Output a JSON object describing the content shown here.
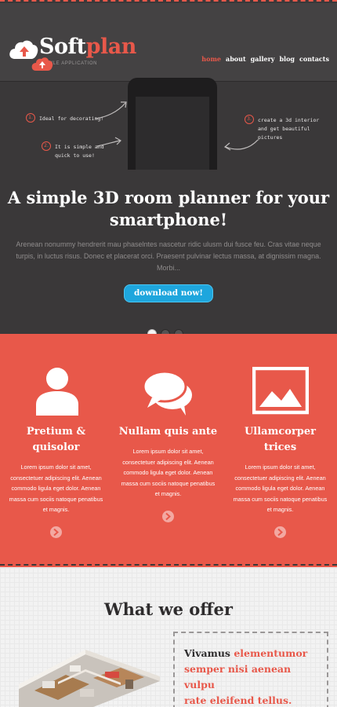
{
  "brand": {
    "name_part1": "Soft",
    "name_part2": "plan",
    "tagline": "MOBILE APPLICATION"
  },
  "nav": {
    "items": [
      "home",
      "about",
      "gallery",
      "blog",
      "contacts"
    ],
    "active": "home"
  },
  "hero": {
    "callout_1": {
      "badge": "1.",
      "line1": "Ideal for decorating!"
    },
    "callout_2": {
      "badge": "2.",
      "line1": "It is simple and",
      "line2": "quick to use!"
    },
    "callout_3": {
      "badge": "3.",
      "line1": "create a 3d interior",
      "line2": "and get beautiful",
      "line3": "pictures"
    },
    "title_line1": "A simple 3D room planner for your",
    "title_line2": "smartphone!",
    "text": "Arenean nonummy hendrerit mau phaselntes nascetur ridic ulusm dui fusce feu. Cras vitae neque turpis, in luctus risus. Donec et placerat orci. Praesent pulvinar lectus massa, at dignissim magna. Morbi...",
    "button_label": "download now!",
    "slides": {
      "count": 3,
      "active_index": 0
    }
  },
  "features": [
    {
      "icon": "user-icon",
      "title_line1": "Pretium &",
      "title_line2": "quisolor",
      "text": [
        "Lorem ipsum dolor sit amet,",
        "consectetuer adipiscing elit. Aenean",
        "commodo ligula eget dolor. Aenean",
        "massa cum sociis natoque penatibus",
        "et magnis."
      ]
    },
    {
      "icon": "chat-bubbles-icon",
      "title_line1": "Nullam quis ante",
      "title_line2": "",
      "text": [
        "Lorem ipsum dolor sit amet,",
        "consectetuer adipiscing elit. Aenean",
        "commodo ligula eget dolor. Aenean",
        "massa cum sociis natoque penatibus",
        "et magnis."
      ]
    },
    {
      "icon": "picture-icon",
      "title_line1": "Ullamcorper",
      "title_line2": "trices",
      "text": [
        "Lorem ipsum dolor sit amet,",
        "consectetuer adipiscing elit. Aenean",
        "commodo ligula eget dolor. Aenean",
        "massa cum sociis natoque penatibus",
        "et magnis."
      ]
    }
  ],
  "offer": {
    "title": "What we offer",
    "box_line1_dark": "Vivamus",
    "box_line1_red": "elementumor",
    "box_line2": "semper nisi aenean",
    "box_line3": "vulpu",
    "box_line4": "rate eleifend tellus."
  },
  "colors": {
    "accent": "#e8584a",
    "hero_bg": "#3a3839",
    "button": "#1ea6dd",
    "offer_bg": "#f2f2f2"
  }
}
